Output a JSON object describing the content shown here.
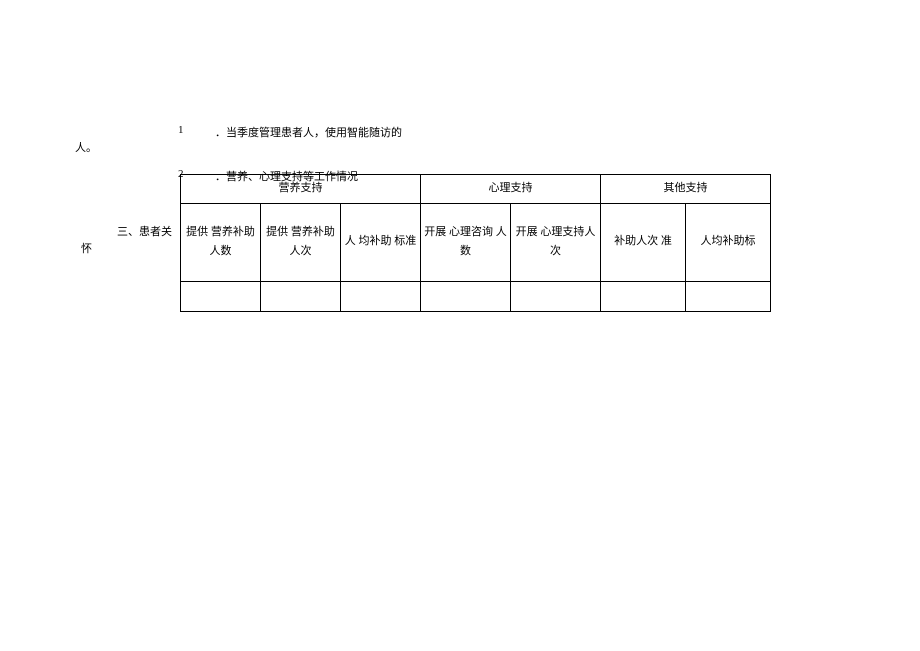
{
  "item1": {
    "num": "1",
    "text": "．当季度管理患者人，使用智能随访的",
    "cont": "人。"
  },
  "item2": {
    "num": "2",
    "text": "．营养、心理支持等工作情况"
  },
  "section": {
    "line1": "三、患者关",
    "line2": "怀"
  },
  "chart_data": {
    "type": "table",
    "groups": [
      {
        "label": "营养支持",
        "span": 3
      },
      {
        "label": "心理支持",
        "span": 2
      },
      {
        "label": "其他支持",
        "span": 2
      }
    ],
    "columns": [
      "提供 营养补助 人数",
      "提供 营养补助 人次",
      "人 均补助 标准",
      "开展 心理咨询 人数",
      "开展 心理支持人 次",
      "补助人次 准",
      "人均补助标"
    ],
    "rows": [
      [
        "",
        "",
        "",
        "",
        "",
        "",
        ""
      ]
    ]
  }
}
